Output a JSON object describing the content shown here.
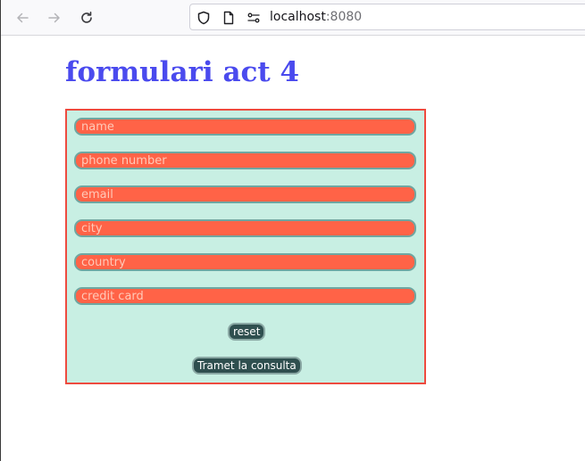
{
  "browser": {
    "url_host": "localhost",
    "url_port": ":8080",
    "icons": [
      "back-arrow-icon",
      "forward-arrow-icon",
      "reload-icon",
      "shield-icon",
      "page-icon",
      "permissions-icon"
    ]
  },
  "page": {
    "title": "formulari act 4",
    "title_color": "#4a4aee"
  },
  "form": {
    "fields": [
      {
        "placeholder": "name"
      },
      {
        "placeholder": "phone number"
      },
      {
        "placeholder": "email"
      },
      {
        "placeholder": "city"
      },
      {
        "placeholder": "country"
      },
      {
        "placeholder": "credit card"
      }
    ],
    "reset_label": "reset",
    "submit_label": "Tramet la consulta",
    "colors": {
      "background": "#c8efe3",
      "border": "#ee4b3f",
      "field": "#ff6347",
      "button": "#2f4f4f"
    }
  }
}
